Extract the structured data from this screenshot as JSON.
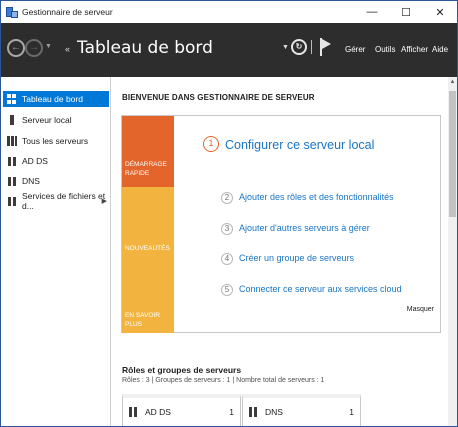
{
  "window": {
    "title": "Gestionnaire de serveur",
    "controls": {
      "minimize": "—",
      "maximize": "☐",
      "close": "✕"
    }
  },
  "header": {
    "title": "Tableau de bord",
    "crumb_arrows": "‹‹",
    "menu": {
      "manage": "Gérer",
      "tools": "Outils",
      "view": "Afficher",
      "help": "Aide"
    }
  },
  "sidebar": {
    "items": [
      {
        "label": "Tableau de bord",
        "icon": "dashboard-icon",
        "selected": true
      },
      {
        "label": "Serveur local",
        "icon": "server-icon"
      },
      {
        "label": "Tous les serveurs",
        "icon": "servers-icon"
      },
      {
        "label": "AD DS",
        "icon": "role-icon"
      },
      {
        "label": "DNS",
        "icon": "role-icon"
      },
      {
        "label": "Services de fichiers et d...",
        "icon": "role-icon",
        "has_submenu": true
      }
    ]
  },
  "welcome": {
    "title": "BIENVENUE DANS GESTIONNAIRE DE SERVEUR",
    "quick_start": "DÉMARRAGE RAPIDE",
    "whats_new": "NOUVEAUTÉS",
    "learn_more": "EN SAVOIR PLUS",
    "steps": [
      {
        "num": "1",
        "text": "Configurer ce serveur local"
      },
      {
        "num": "2",
        "text": "Ajouter des rôles et des fonctionnalités"
      },
      {
        "num": "3",
        "text": "Ajouter d'autres serveurs à gérer"
      },
      {
        "num": "4",
        "text": "Créer un groupe de serveurs"
      },
      {
        "num": "5",
        "text": "Connecter ce serveur aux services cloud"
      }
    ],
    "hide": "Masquer"
  },
  "roles": {
    "title": "Rôles et groupes de serveurs",
    "meta": "Rôles : 3   |   Groupes de serveurs : 1   |   Nombre total de serveurs : 1",
    "cards": [
      {
        "name": "AD DS",
        "count": "1"
      },
      {
        "name": "DNS",
        "count": "1"
      }
    ]
  },
  "colors": {
    "accent": "#0078d7",
    "header_bg": "#2d2d2d",
    "quick_start": "#e3652b",
    "tile_yellow": "#f2b43f",
    "link": "#1a75c4"
  }
}
